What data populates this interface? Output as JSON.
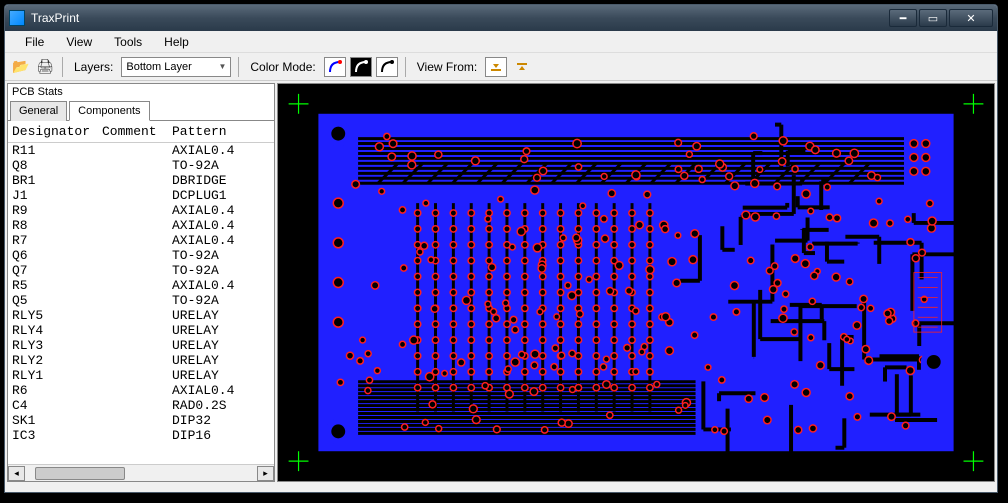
{
  "window": {
    "title": "TraxPrint"
  },
  "menubar": {
    "file": "File",
    "view": "View",
    "tools": "Tools",
    "help": "Help"
  },
  "toolbar": {
    "layers_label": "Layers:",
    "layer_selected": "Bottom Layer",
    "colormode_label": "Color Mode:",
    "viewfrom_label": "View From:"
  },
  "panel": {
    "title": "PCB Stats",
    "tab_general": "General",
    "tab_components": "Components",
    "header_designator": "Designator",
    "header_comment": "Comment",
    "header_pattern": "Pattern"
  },
  "components": [
    {
      "designator": "R11",
      "comment": "",
      "pattern": "AXIAL0.4"
    },
    {
      "designator": "Q8",
      "comment": "",
      "pattern": "TO-92A"
    },
    {
      "designator": "BR1",
      "comment": "",
      "pattern": "DBRIDGE"
    },
    {
      "designator": "J1",
      "comment": "",
      "pattern": "DCPLUG1"
    },
    {
      "designator": "R9",
      "comment": "",
      "pattern": "AXIAL0.4"
    },
    {
      "designator": "R8",
      "comment": "",
      "pattern": "AXIAL0.4"
    },
    {
      "designator": "R7",
      "comment": "",
      "pattern": "AXIAL0.4"
    },
    {
      "designator": "Q6",
      "comment": "",
      "pattern": "TO-92A"
    },
    {
      "designator": "Q7",
      "comment": "",
      "pattern": "TO-92A"
    },
    {
      "designator": "R5",
      "comment": "",
      "pattern": "AXIAL0.4"
    },
    {
      "designator": "Q5",
      "comment": "",
      "pattern": "TO-92A"
    },
    {
      "designator": "RLY5",
      "comment": "",
      "pattern": "URELAY"
    },
    {
      "designator": "RLY4",
      "comment": "",
      "pattern": "URELAY"
    },
    {
      "designator": "RLY3",
      "comment": "",
      "pattern": "URELAY"
    },
    {
      "designator": "RLY2",
      "comment": "",
      "pattern": "URELAY"
    },
    {
      "designator": "RLY1",
      "comment": "",
      "pattern": "URELAY"
    },
    {
      "designator": "R6",
      "comment": "",
      "pattern": "AXIAL0.4"
    },
    {
      "designator": "C4",
      "comment": "",
      "pattern": "RAD0.2S"
    },
    {
      "designator": "SK1",
      "comment": "",
      "pattern": "DIP32"
    },
    {
      "designator": "IC3",
      "comment": "",
      "pattern": "DIP16"
    }
  ],
  "pcb": {
    "copper_color": "#2020ff",
    "pad_color": "#ff2020",
    "mark_color": "#00ff00",
    "bg_color": "#000000"
  }
}
